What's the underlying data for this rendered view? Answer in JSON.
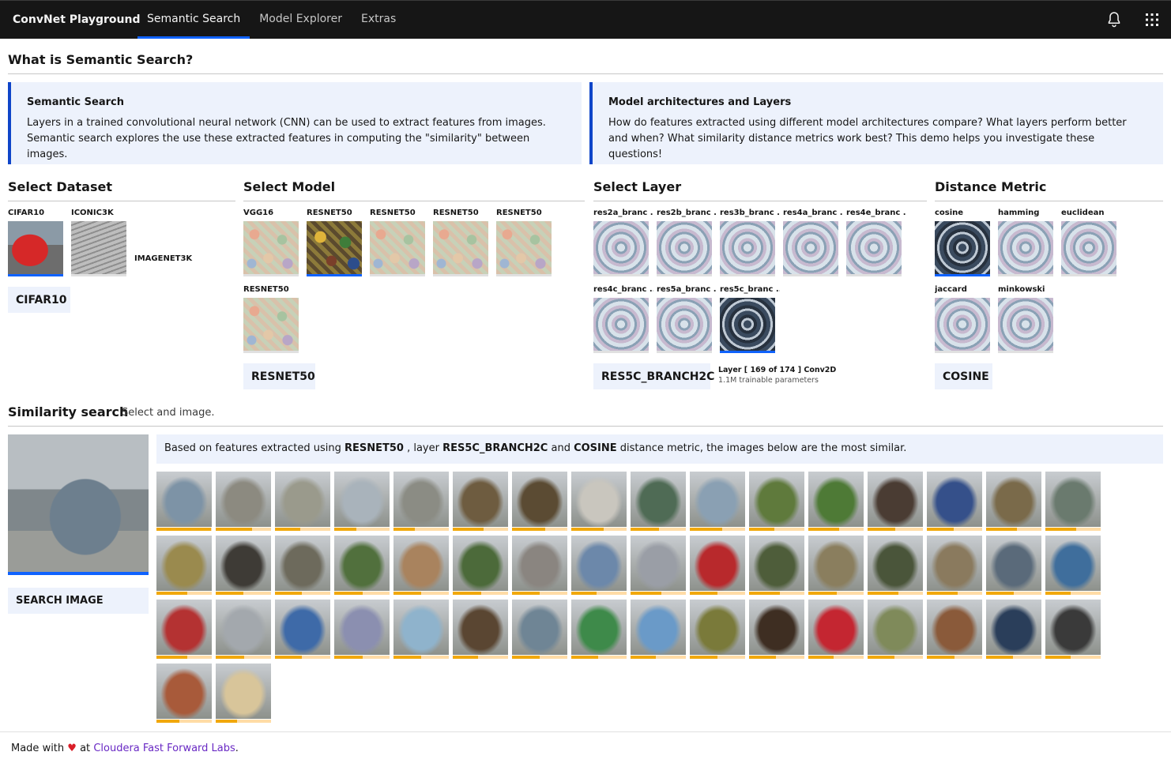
{
  "header": {
    "brand": "ConvNet Playground",
    "nav": [
      "Semantic Search",
      "Model Explorer",
      "Extras"
    ],
    "active_nav": "Semantic Search",
    "icons": [
      "bell-icon",
      "app-switcher-icon"
    ]
  },
  "intro": {
    "title": "What is Semantic Search?",
    "tile1": {
      "title": "Semantic Search",
      "body": "Layers in a trained convolutional neural network (CNN) can be used to extract features from images. Semantic search explores the use these extracted features in computing the \"similarity\" between images."
    },
    "tile2": {
      "title": "Model architectures and Layers",
      "body": "How do features extracted using different model architectures compare? What layers perform better and when? What similarity distance metrics work best? This demo helps you investigate these questions!"
    }
  },
  "dataset": {
    "title": "Select Dataset",
    "items": [
      "CIFAR10",
      "ICONIC3K",
      "IMAGENET3K"
    ],
    "selected": "CIFAR10"
  },
  "model": {
    "title": "Select Model",
    "items": [
      "VGG16",
      "RESNET50",
      "RESNET50",
      "RESNET50",
      "RESNET50",
      "RESNET50"
    ],
    "selected": "RESNET50"
  },
  "layer": {
    "title": "Select Layer",
    "items": [
      "res2a_branc ..",
      "res2b_branc ..",
      "res3b_branc ..",
      "res4a_branc ..",
      "res4e_branc ..",
      "res4c_branc ..",
      "res5a_branc ..",
      "res5c_branc .."
    ],
    "selected": "RES5C_BRANCH2C",
    "info_line1": "Layer [ 169 of 174 ] Conv2D",
    "info_line2": "1.1M trainable parameters"
  },
  "metric": {
    "title": "Distance Metric",
    "items": [
      "cosine",
      "hamming",
      "euclidean",
      "jaccard",
      "minkowski"
    ],
    "selected": "COSINE"
  },
  "similarity": {
    "title": "Similarity search",
    "subtitle": "Select and image.",
    "search_button": "SEARCH IMAGE",
    "note_prefix": "Based on features extracted using",
    "note_model": "RESNET50",
    "note_mid1": ", layer",
    "note_layer": "RES5C_BRANCH2C",
    "note_mid2": "and",
    "note_metric": "COSINE",
    "note_suffix": "distance metric, the images below are the most similar.",
    "results": [
      {
        "color": "#7d93a6",
        "score": 0.98
      },
      {
        "color": "#8c8a80",
        "score": 0.65
      },
      {
        "color": "#9a9a8c",
        "score": 0.45
      },
      {
        "color": "#a9b3bb",
        "score": 0.4
      },
      {
        "color": "#8b8c84",
        "score": 0.38
      },
      {
        "color": "#6e5c40",
        "score": 0.55
      },
      {
        "color": "#5b4b33",
        "score": 0.6
      },
      {
        "color": "#c9c6be",
        "score": 0.58
      },
      {
        "color": "#4f6b55",
        "score": 0.52
      },
      {
        "color": "#8aa0b3",
        "score": 0.58
      },
      {
        "color": "#5f7a3c",
        "score": 0.45
      },
      {
        "color": "#4e7a36",
        "score": 0.55
      },
      {
        "color": "#4a3c33",
        "score": 0.5
      },
      {
        "color": "#35508a",
        "score": 0.48
      },
      {
        "color": "#7a6a4a",
        "score": 0.56
      },
      {
        "color": "#6a7a6e",
        "score": 0.55
      },
      {
        "color": "#9a8a4e",
        "score": 0.55
      },
      {
        "color": "#3e3b36",
        "score": 0.5
      },
      {
        "color": "#6d6a5c",
        "score": 0.48
      },
      {
        "color": "#51703d",
        "score": 0.52
      },
      {
        "color": "#a9835e",
        "score": 0.5
      },
      {
        "color": "#4c6a3a",
        "score": 0.52
      },
      {
        "color": "#8a8580",
        "score": 0.5
      },
      {
        "color": "#6c88aa",
        "score": 0.45
      },
      {
        "color": "#9a9ea6",
        "score": 0.55
      },
      {
        "color": "#b8292c",
        "score": 0.5
      },
      {
        "color": "#4e5d3a",
        "score": 0.55
      },
      {
        "color": "#8a7e5e",
        "score": 0.52
      },
      {
        "color": "#4a553a",
        "score": 0.55
      },
      {
        "color": "#8a7a5e",
        "score": 0.55
      },
      {
        "color": "#5a6a7a",
        "score": 0.5
      },
      {
        "color": "#3f6e9c",
        "score": 0.45
      },
      {
        "color": "#b43232",
        "score": 0.55
      },
      {
        "color": "#a3a8ad",
        "score": 0.52
      },
      {
        "color": "#3e6aa8",
        "score": 0.48
      },
      {
        "color": "#8b8fb0",
        "score": 0.52
      },
      {
        "color": "#8fb3cc",
        "score": 0.5
      },
      {
        "color": "#5a4632",
        "score": 0.45
      },
      {
        "color": "#6f8595",
        "score": 0.5
      },
      {
        "color": "#3e8a4a",
        "score": 0.48
      },
      {
        "color": "#6a9ac8",
        "score": 0.45
      },
      {
        "color": "#7a7a3a",
        "score": 0.5
      },
      {
        "color": "#3e2e22",
        "score": 0.48
      },
      {
        "color": "#c42631",
        "score": 0.45
      },
      {
        "color": "#7f8a5a",
        "score": 0.48
      },
      {
        "color": "#8a5a3a",
        "score": 0.5
      },
      {
        "color": "#2a3e5a",
        "score": 0.48
      },
      {
        "color": "#3a3a3a",
        "score": 0.45
      },
      {
        "color": "#a85a3a",
        "score": 0.42
      },
      {
        "color": "#d8c59a",
        "score": 0.38
      }
    ]
  },
  "footer": {
    "prefix": "Made with",
    "heart": "♥",
    "at": "at",
    "link": "Cloudera Fast Forward Labs",
    "suffix": "."
  }
}
